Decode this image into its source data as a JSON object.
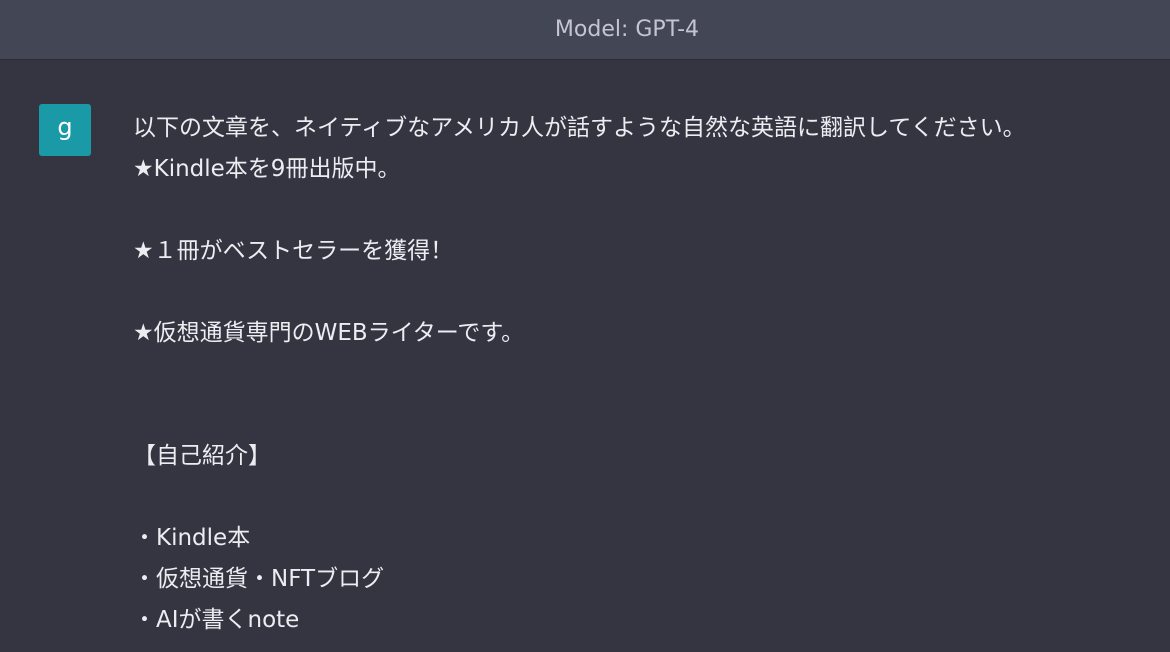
{
  "header": {
    "model_label": "Model: GPT-4"
  },
  "user": {
    "avatar_letter": "g",
    "avatar_color": "#1a9aa6"
  },
  "message": {
    "lines": [
      "以下の文章を、ネイティブなアメリカ人が話すような自然な英語に翻訳してください。",
      "★Kindle本を9冊出版中。",
      "",
      "★１冊がベストセラーを獲得！",
      "",
      "★仮想通貨専門のWEBライターです。",
      "",
      "",
      "【自己紹介】",
      "",
      "・Kindle本",
      "・仮想通貨・NFTブログ",
      "・AIが書くnote"
    ]
  },
  "colors": {
    "background": "#343541",
    "header_background": "#434654",
    "text": "#ececf1",
    "header_text": "#c5c5d2"
  }
}
